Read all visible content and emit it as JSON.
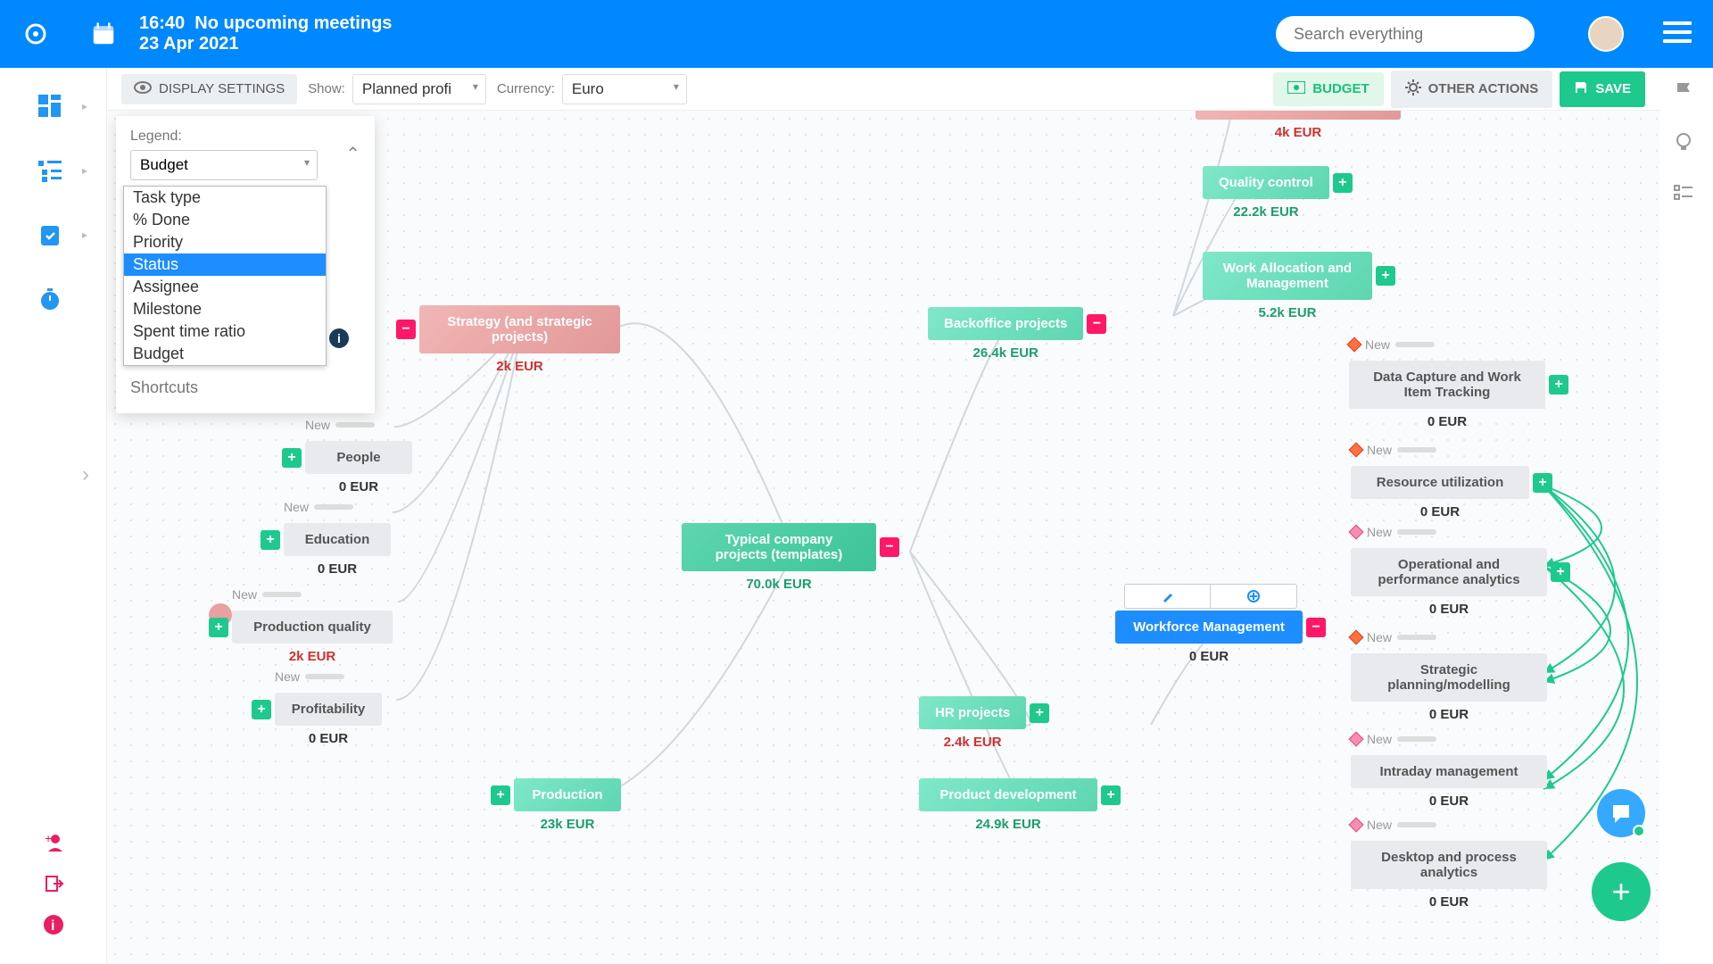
{
  "header": {
    "time": "16:40",
    "meetings": "No upcoming meetings",
    "date": "23 Apr 2021",
    "search_placeholder": "Search everything"
  },
  "toolbar": {
    "display_settings": "DISPLAY SETTINGS",
    "show_label": "Show:",
    "show_value": "Planned profi",
    "currency_label": "Currency:",
    "currency_value": "Euro",
    "budget": "BUDGET",
    "other_actions": "OTHER ACTIONS",
    "save": "SAVE"
  },
  "legend": {
    "label": "Legend:",
    "selected": "Budget",
    "options": [
      "Task type",
      "% Done",
      "Priority",
      "Status",
      "Assignee",
      "Milestone",
      "Spent time ratio",
      "Budget"
    ],
    "highlight": "Status",
    "shortcuts": "Shortcuts"
  },
  "nodes": {
    "n_top_red": {
      "sub": "4k EUR"
    },
    "quality_control": {
      "title": "Quality control",
      "sub": "22.2k EUR"
    },
    "work_alloc": {
      "title": "Work Allocation and Management",
      "sub": "5.2k EUR"
    },
    "strategy": {
      "title": "Strategy (and strategic projects)",
      "sub": "2k EUR"
    },
    "backoffice": {
      "title": "Backoffice projects",
      "sub": "26.4k EUR"
    },
    "center": {
      "title": "Typical company projects (templates)",
      "sub": "70.0k EUR"
    },
    "people": {
      "status": "New",
      "title": "People",
      "sub": "0 EUR"
    },
    "education": {
      "status": "New",
      "title": "Education",
      "sub": "0 EUR"
    },
    "prodq": {
      "status": "New",
      "title": "Production quality",
      "sub": "2k EUR"
    },
    "profitability": {
      "status": "New",
      "title": "Profitability",
      "sub": "0 EUR"
    },
    "production": {
      "title": "Production",
      "sub": "23k EUR"
    },
    "hr": {
      "title": "HR projects",
      "sub": "2.4k EUR"
    },
    "proddev": {
      "title": "Product development",
      "sub": "24.9k EUR"
    },
    "workforce": {
      "title": "Workforce Management",
      "sub": "0 EUR"
    },
    "data_capture": {
      "status": "New",
      "title": "Data Capture and Work Item Tracking",
      "sub": "0 EUR"
    },
    "resource": {
      "status": "New",
      "title": "Resource utilization",
      "sub": "0 EUR"
    },
    "operational": {
      "status": "New",
      "title": "Operational and performance analytics",
      "sub": "0 EUR"
    },
    "strategic": {
      "status": "New",
      "title": "Strategic planning/modelling",
      "sub": "0 EUR"
    },
    "intraday": {
      "status": "New",
      "title": "Intraday management",
      "sub": "0 EUR"
    },
    "desktop": {
      "status": "New",
      "title": "Desktop and process analytics",
      "sub": "0 EUR"
    }
  }
}
